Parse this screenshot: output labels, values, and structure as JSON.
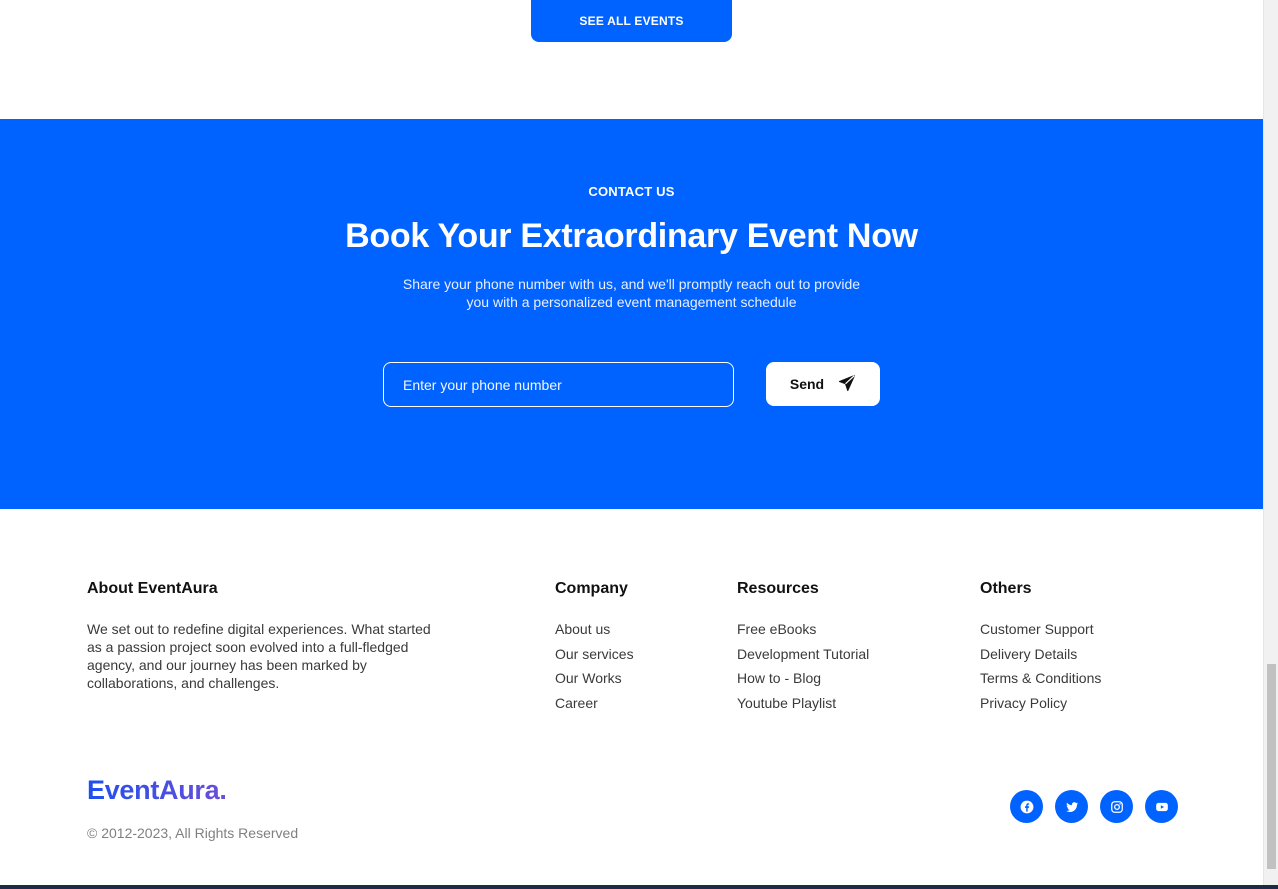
{
  "top": {
    "see_all_label": "SEE ALL EVENTS"
  },
  "contact": {
    "eyebrow": "CONTACT US",
    "heading": "Book Your Extraordinary Event Now",
    "subtext": "Share your phone number with us, and we'll promptly reach out to provide you with a personalized event management schedule",
    "phone_placeholder": "Enter your phone number",
    "phone_value": "",
    "send_label": "Send",
    "send_icon": "paper-plane-icon"
  },
  "footer": {
    "about": {
      "title": "About EventAura",
      "text": "We set out to redefine digital experiences. What started as a passion project soon evolved into a full-fledged agency, and our journey has been marked by collaborations, and challenges."
    },
    "company": {
      "title": "Company",
      "links": [
        "About us",
        "Our services",
        "Our Works",
        "Career"
      ]
    },
    "resources": {
      "title": "Resources",
      "links": [
        "Free eBooks",
        "Development Tutorial",
        "How to - Blog",
        "Youtube Playlist"
      ]
    },
    "others": {
      "title": "Others",
      "links": [
        "Customer Support",
        "Delivery Details",
        "Terms & Conditions",
        "Privacy Policy"
      ]
    },
    "brand": "EventAura.",
    "copyright": "© 2012-2023, All Rights Reserved",
    "social": [
      "facebook-icon",
      "twitter-icon",
      "instagram-icon",
      "youtube-icon"
    ]
  },
  "colors": {
    "accent": "#0062ff",
    "text": "#111111",
    "muted": "#808080",
    "brand_gradient_start": "#1e4ff0",
    "brand_gradient_end": "#6a4fd6"
  }
}
